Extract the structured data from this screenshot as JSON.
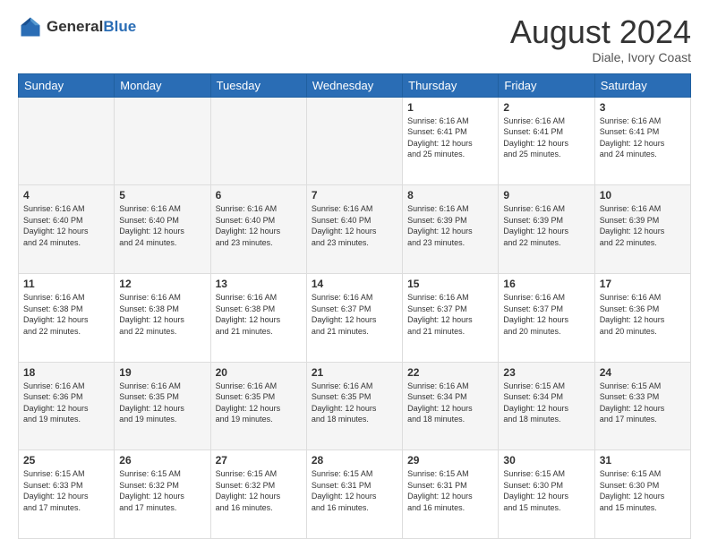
{
  "header": {
    "logo_general": "General",
    "logo_blue": "Blue",
    "month_title": "August 2024",
    "subtitle": "Diale, Ivory Coast"
  },
  "calendar": {
    "days_of_week": [
      "Sunday",
      "Monday",
      "Tuesday",
      "Wednesday",
      "Thursday",
      "Friday",
      "Saturday"
    ],
    "weeks": [
      [
        {
          "day": "",
          "info": ""
        },
        {
          "day": "",
          "info": ""
        },
        {
          "day": "",
          "info": ""
        },
        {
          "day": "",
          "info": ""
        },
        {
          "day": "1",
          "info": "Sunrise: 6:16 AM\nSunset: 6:41 PM\nDaylight: 12 hours\nand 25 minutes."
        },
        {
          "day": "2",
          "info": "Sunrise: 6:16 AM\nSunset: 6:41 PM\nDaylight: 12 hours\nand 25 minutes."
        },
        {
          "day": "3",
          "info": "Sunrise: 6:16 AM\nSunset: 6:41 PM\nDaylight: 12 hours\nand 24 minutes."
        }
      ],
      [
        {
          "day": "4",
          "info": "Sunrise: 6:16 AM\nSunset: 6:40 PM\nDaylight: 12 hours\nand 24 minutes."
        },
        {
          "day": "5",
          "info": "Sunrise: 6:16 AM\nSunset: 6:40 PM\nDaylight: 12 hours\nand 24 minutes."
        },
        {
          "day": "6",
          "info": "Sunrise: 6:16 AM\nSunset: 6:40 PM\nDaylight: 12 hours\nand 23 minutes."
        },
        {
          "day": "7",
          "info": "Sunrise: 6:16 AM\nSunset: 6:40 PM\nDaylight: 12 hours\nand 23 minutes."
        },
        {
          "day": "8",
          "info": "Sunrise: 6:16 AM\nSunset: 6:39 PM\nDaylight: 12 hours\nand 23 minutes."
        },
        {
          "day": "9",
          "info": "Sunrise: 6:16 AM\nSunset: 6:39 PM\nDaylight: 12 hours\nand 22 minutes."
        },
        {
          "day": "10",
          "info": "Sunrise: 6:16 AM\nSunset: 6:39 PM\nDaylight: 12 hours\nand 22 minutes."
        }
      ],
      [
        {
          "day": "11",
          "info": "Sunrise: 6:16 AM\nSunset: 6:38 PM\nDaylight: 12 hours\nand 22 minutes."
        },
        {
          "day": "12",
          "info": "Sunrise: 6:16 AM\nSunset: 6:38 PM\nDaylight: 12 hours\nand 22 minutes."
        },
        {
          "day": "13",
          "info": "Sunrise: 6:16 AM\nSunset: 6:38 PM\nDaylight: 12 hours\nand 21 minutes."
        },
        {
          "day": "14",
          "info": "Sunrise: 6:16 AM\nSunset: 6:37 PM\nDaylight: 12 hours\nand 21 minutes."
        },
        {
          "day": "15",
          "info": "Sunrise: 6:16 AM\nSunset: 6:37 PM\nDaylight: 12 hours\nand 21 minutes."
        },
        {
          "day": "16",
          "info": "Sunrise: 6:16 AM\nSunset: 6:37 PM\nDaylight: 12 hours\nand 20 minutes."
        },
        {
          "day": "17",
          "info": "Sunrise: 6:16 AM\nSunset: 6:36 PM\nDaylight: 12 hours\nand 20 minutes."
        }
      ],
      [
        {
          "day": "18",
          "info": "Sunrise: 6:16 AM\nSunset: 6:36 PM\nDaylight: 12 hours\nand 19 minutes."
        },
        {
          "day": "19",
          "info": "Sunrise: 6:16 AM\nSunset: 6:35 PM\nDaylight: 12 hours\nand 19 minutes."
        },
        {
          "day": "20",
          "info": "Sunrise: 6:16 AM\nSunset: 6:35 PM\nDaylight: 12 hours\nand 19 minutes."
        },
        {
          "day": "21",
          "info": "Sunrise: 6:16 AM\nSunset: 6:35 PM\nDaylight: 12 hours\nand 18 minutes."
        },
        {
          "day": "22",
          "info": "Sunrise: 6:16 AM\nSunset: 6:34 PM\nDaylight: 12 hours\nand 18 minutes."
        },
        {
          "day": "23",
          "info": "Sunrise: 6:15 AM\nSunset: 6:34 PM\nDaylight: 12 hours\nand 18 minutes."
        },
        {
          "day": "24",
          "info": "Sunrise: 6:15 AM\nSunset: 6:33 PM\nDaylight: 12 hours\nand 17 minutes."
        }
      ],
      [
        {
          "day": "25",
          "info": "Sunrise: 6:15 AM\nSunset: 6:33 PM\nDaylight: 12 hours\nand 17 minutes."
        },
        {
          "day": "26",
          "info": "Sunrise: 6:15 AM\nSunset: 6:32 PM\nDaylight: 12 hours\nand 17 minutes."
        },
        {
          "day": "27",
          "info": "Sunrise: 6:15 AM\nSunset: 6:32 PM\nDaylight: 12 hours\nand 16 minutes."
        },
        {
          "day": "28",
          "info": "Sunrise: 6:15 AM\nSunset: 6:31 PM\nDaylight: 12 hours\nand 16 minutes."
        },
        {
          "day": "29",
          "info": "Sunrise: 6:15 AM\nSunset: 6:31 PM\nDaylight: 12 hours\nand 16 minutes."
        },
        {
          "day": "30",
          "info": "Sunrise: 6:15 AM\nSunset: 6:30 PM\nDaylight: 12 hours\nand 15 minutes."
        },
        {
          "day": "31",
          "info": "Sunrise: 6:15 AM\nSunset: 6:30 PM\nDaylight: 12 hours\nand 15 minutes."
        }
      ]
    ]
  }
}
